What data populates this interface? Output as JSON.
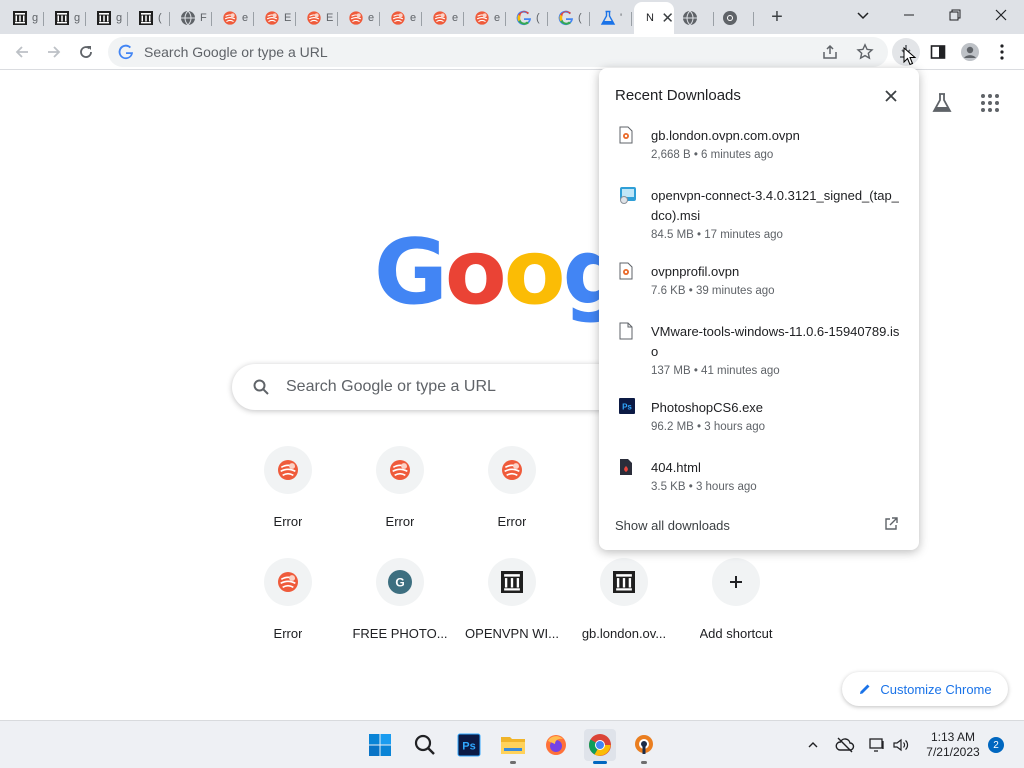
{
  "tabs": [
    {
      "icon": "archive-icon",
      "title": "g"
    },
    {
      "icon": "archive-icon",
      "title": "g"
    },
    {
      "icon": "archive-icon",
      "title": "g"
    },
    {
      "icon": "archive-icon",
      "title": "("
    },
    {
      "icon": "globe-icon",
      "title": "F"
    },
    {
      "icon": "error-icon",
      "title": "e"
    },
    {
      "icon": "error-icon",
      "title": "E"
    },
    {
      "icon": "error-icon",
      "title": "E"
    },
    {
      "icon": "error-icon",
      "title": "e"
    },
    {
      "icon": "error-icon",
      "title": "e"
    },
    {
      "icon": "error-icon",
      "title": "e"
    },
    {
      "icon": "error-icon",
      "title": "e"
    },
    {
      "icon": "google-icon",
      "title": "("
    },
    {
      "icon": "google-icon",
      "title": "("
    },
    {
      "icon": "flask-icon",
      "title": "'"
    },
    {
      "icon": "",
      "title": "N",
      "active": true
    },
    {
      "icon": "globe-icon",
      "title": ""
    },
    {
      "icon": "chrome-icon",
      "title": ""
    }
  ],
  "omnibox": {
    "placeholder": "Search Google or type a URL"
  },
  "ntp": {
    "logo": "Google",
    "search_placeholder": "Search Google or type a URL",
    "shortcuts": [
      {
        "label": "Error",
        "icon": "error-icon"
      },
      {
        "label": "Error",
        "icon": "error-icon"
      },
      {
        "label": "Error",
        "icon": "error-icon"
      },
      {
        "label": "Error",
        "icon": "error-icon"
      },
      {
        "label": "FREE PHOTO...",
        "icon": "g-letter-icon"
      },
      {
        "label": "OPENVPN WI...",
        "icon": "archive-icon"
      },
      {
        "label": "gb.london.ov...",
        "icon": "archive-icon"
      },
      {
        "label": "Add shortcut",
        "icon": "plus-icon"
      }
    ],
    "customize_label": "Customize Chrome"
  },
  "downloads": {
    "title": "Recent Downloads",
    "items": [
      {
        "name": "gb.london.ovpn.com.ovpn",
        "meta": "2,668 B • 6 minutes ago",
        "icon": "ovpn-file-icon"
      },
      {
        "name": "openvpn-connect-3.4.0.3121_signed_(tap_dco).msi",
        "meta": "84.5 MB • 17 minutes ago",
        "icon": "msi-file-icon"
      },
      {
        "name": "ovpnprofil.ovpn",
        "meta": "7.6 KB • 39 minutes ago",
        "icon": "ovpn-file-icon"
      },
      {
        "name": "VMware-tools-windows-11.0.6-15940789.iso",
        "meta": "137 MB • 41 minutes ago",
        "icon": "blank-file-icon"
      },
      {
        "name": "PhotoshopCS6.exe",
        "meta": "96.2 MB • 3 hours ago",
        "icon": "photoshop-file-icon"
      },
      {
        "name": "404.html",
        "meta": "3.5 KB • 3 hours ago",
        "icon": "html-file-icon"
      }
    ],
    "show_all": "Show all downloads"
  },
  "taskbar": {
    "time": "1:13 AM",
    "date": "7/21/2023",
    "notification_count": "2",
    "apps": [
      "windows-start-icon",
      "search-icon",
      "photoshop-icon",
      "file-explorer-icon",
      "firefox-icon",
      "chrome-icon",
      "openvpn-icon"
    ]
  }
}
